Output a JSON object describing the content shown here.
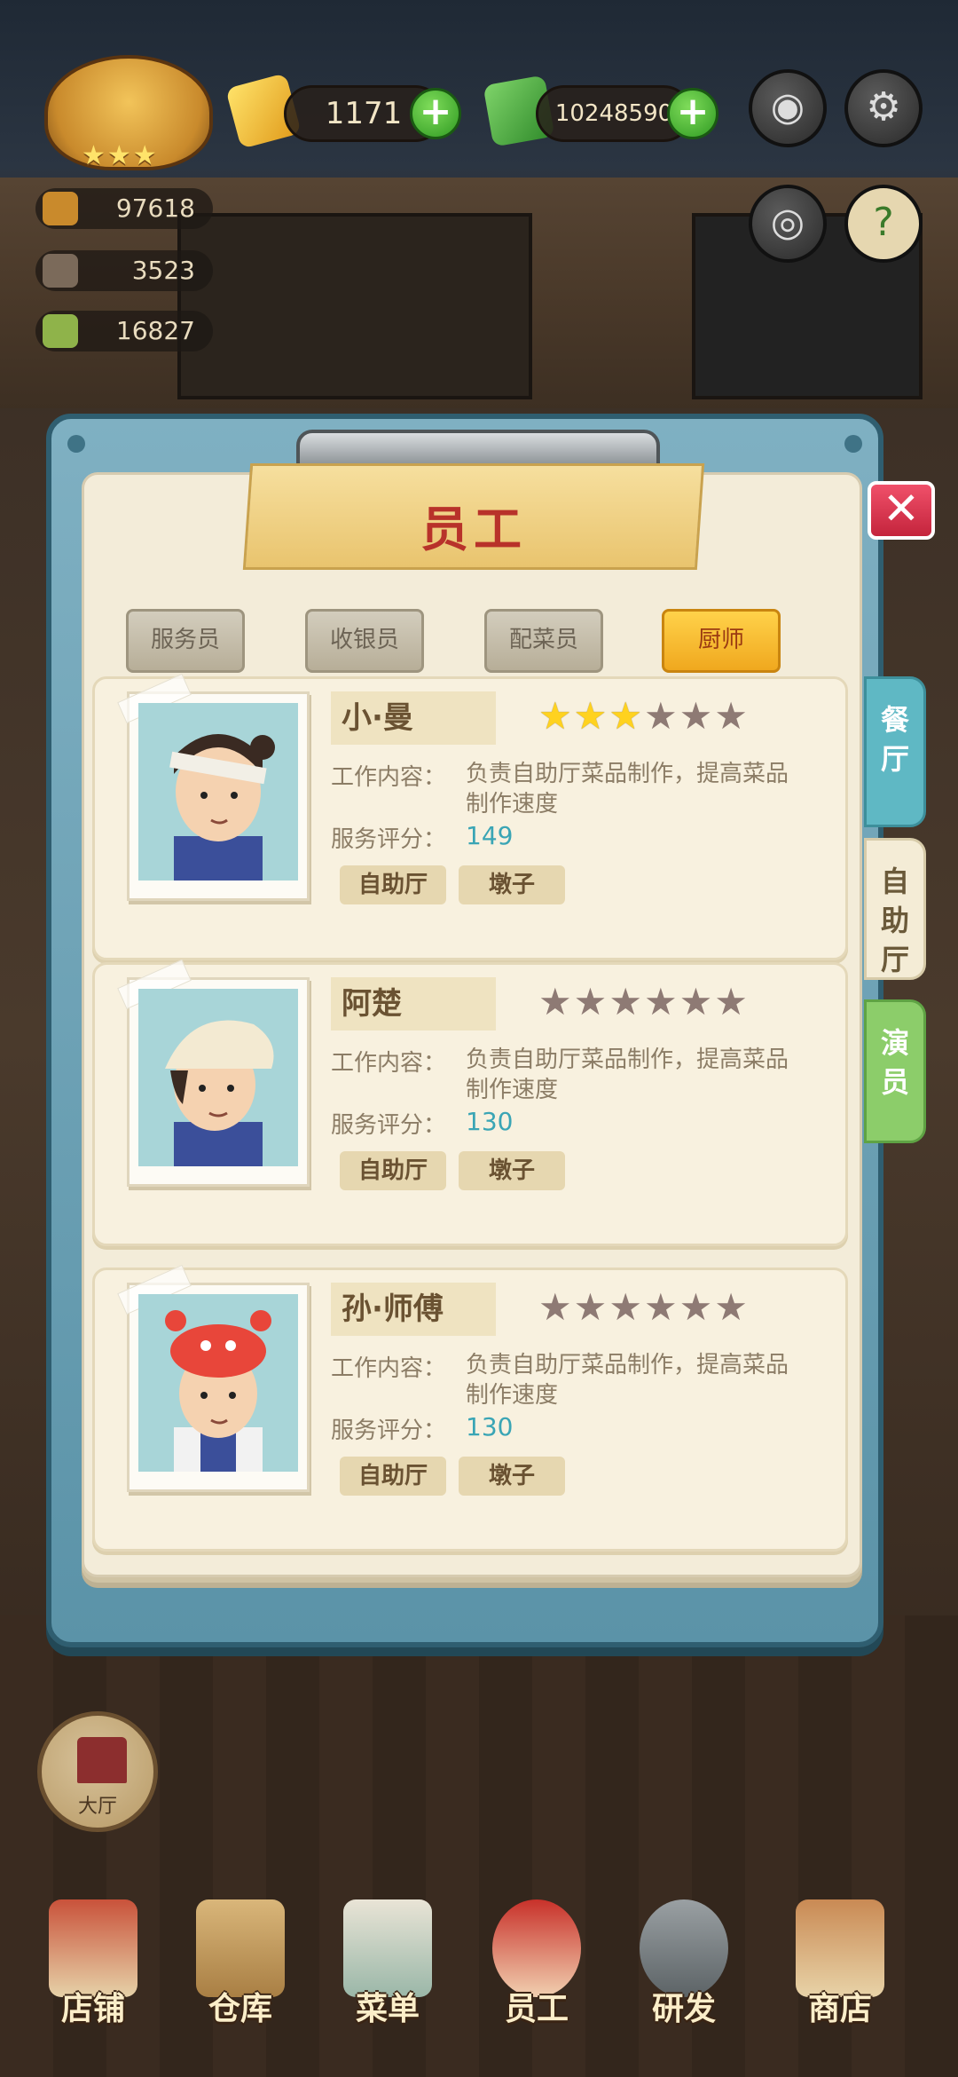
{
  "hud": {
    "gems": "1171",
    "cash": "10248590",
    "stats": [
      "97618",
      "3523",
      "16827"
    ]
  },
  "panel": {
    "title": "员工",
    "tabs": [
      "服务员",
      "收银员",
      "配菜员",
      "厨师"
    ],
    "active_tab": "厨师",
    "side_tabs": [
      "餐厅",
      "自助厅",
      "演员"
    ]
  },
  "labels": {
    "work_content": "工作内容：",
    "service_rating": "服务评分："
  },
  "staff": [
    {
      "name": "小·曼",
      "stars_filled": 3,
      "stars_total": 6,
      "description": "负责自助厅菜品制作，提高菜品制作速度",
      "score": "149",
      "tags": [
        "自助厅",
        "墩子"
      ]
    },
    {
      "name": "阿楚",
      "stars_filled": 0,
      "stars_total": 6,
      "description": "负责自助厅菜品制作，提高菜品制作速度",
      "score": "130",
      "tags": [
        "自助厅",
        "墩子"
      ]
    },
    {
      "name": "孙·师傅",
      "stars_filled": 0,
      "stars_total": 6,
      "description": "负责自助厅菜品制作，提高菜品制作速度",
      "score": "130",
      "tags": [
        "自助厅",
        "墩子"
      ]
    }
  ],
  "home_button": "大厅",
  "bottom_nav": [
    "店铺",
    "仓库",
    "菜单",
    "员工",
    "研发",
    "商店"
  ]
}
